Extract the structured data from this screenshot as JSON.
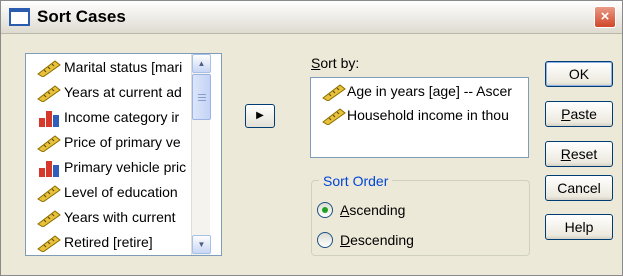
{
  "window": {
    "title": "Sort Cases",
    "close_glyph": "×"
  },
  "variables": {
    "items": [
      {
        "label": "Marital status [mari",
        "icon": "ruler-icon"
      },
      {
        "label": "Years at current ad",
        "icon": "ruler-icon"
      },
      {
        "label": "Income category ir",
        "icon": "bar-chart-icon"
      },
      {
        "label": "Price of primary ve",
        "icon": "ruler-icon"
      },
      {
        "label": "Primary vehicle pric",
        "icon": "bar-chart-icon"
      },
      {
        "label": "Level of education",
        "icon": "ruler-icon"
      },
      {
        "label": "Years with current",
        "icon": "ruler-icon"
      },
      {
        "label": "Retired [retire]",
        "icon": "ruler-icon"
      }
    ],
    "scroll_up": "▲",
    "scroll_down": "▼"
  },
  "move_button": {
    "glyph": "▶"
  },
  "sort_by": {
    "label_u": "S",
    "label_rest": "ort by:",
    "items": [
      {
        "label": "Age in years [age] -- Ascer",
        "icon": "ruler-icon"
      },
      {
        "label": "Household income in thou",
        "icon": "ruler-icon"
      }
    ]
  },
  "sort_order": {
    "title": "Sort Order",
    "ascending_u": "A",
    "ascending_rest": "scending",
    "descending_u": "D",
    "descending_rest": "escending",
    "selected": "ascending"
  },
  "buttons": {
    "ok": "OK",
    "paste_u": "P",
    "paste_rest": "aste",
    "reset_u": "R",
    "reset_rest": "eset",
    "cancel": "Cancel",
    "help": "Help"
  },
  "colors": {
    "dialog_bg": "#ece9d8",
    "accent_border": "#003c74",
    "group_title": "#0046d5",
    "radio_dot": "#21a121",
    "close_button": "#d0482a"
  }
}
